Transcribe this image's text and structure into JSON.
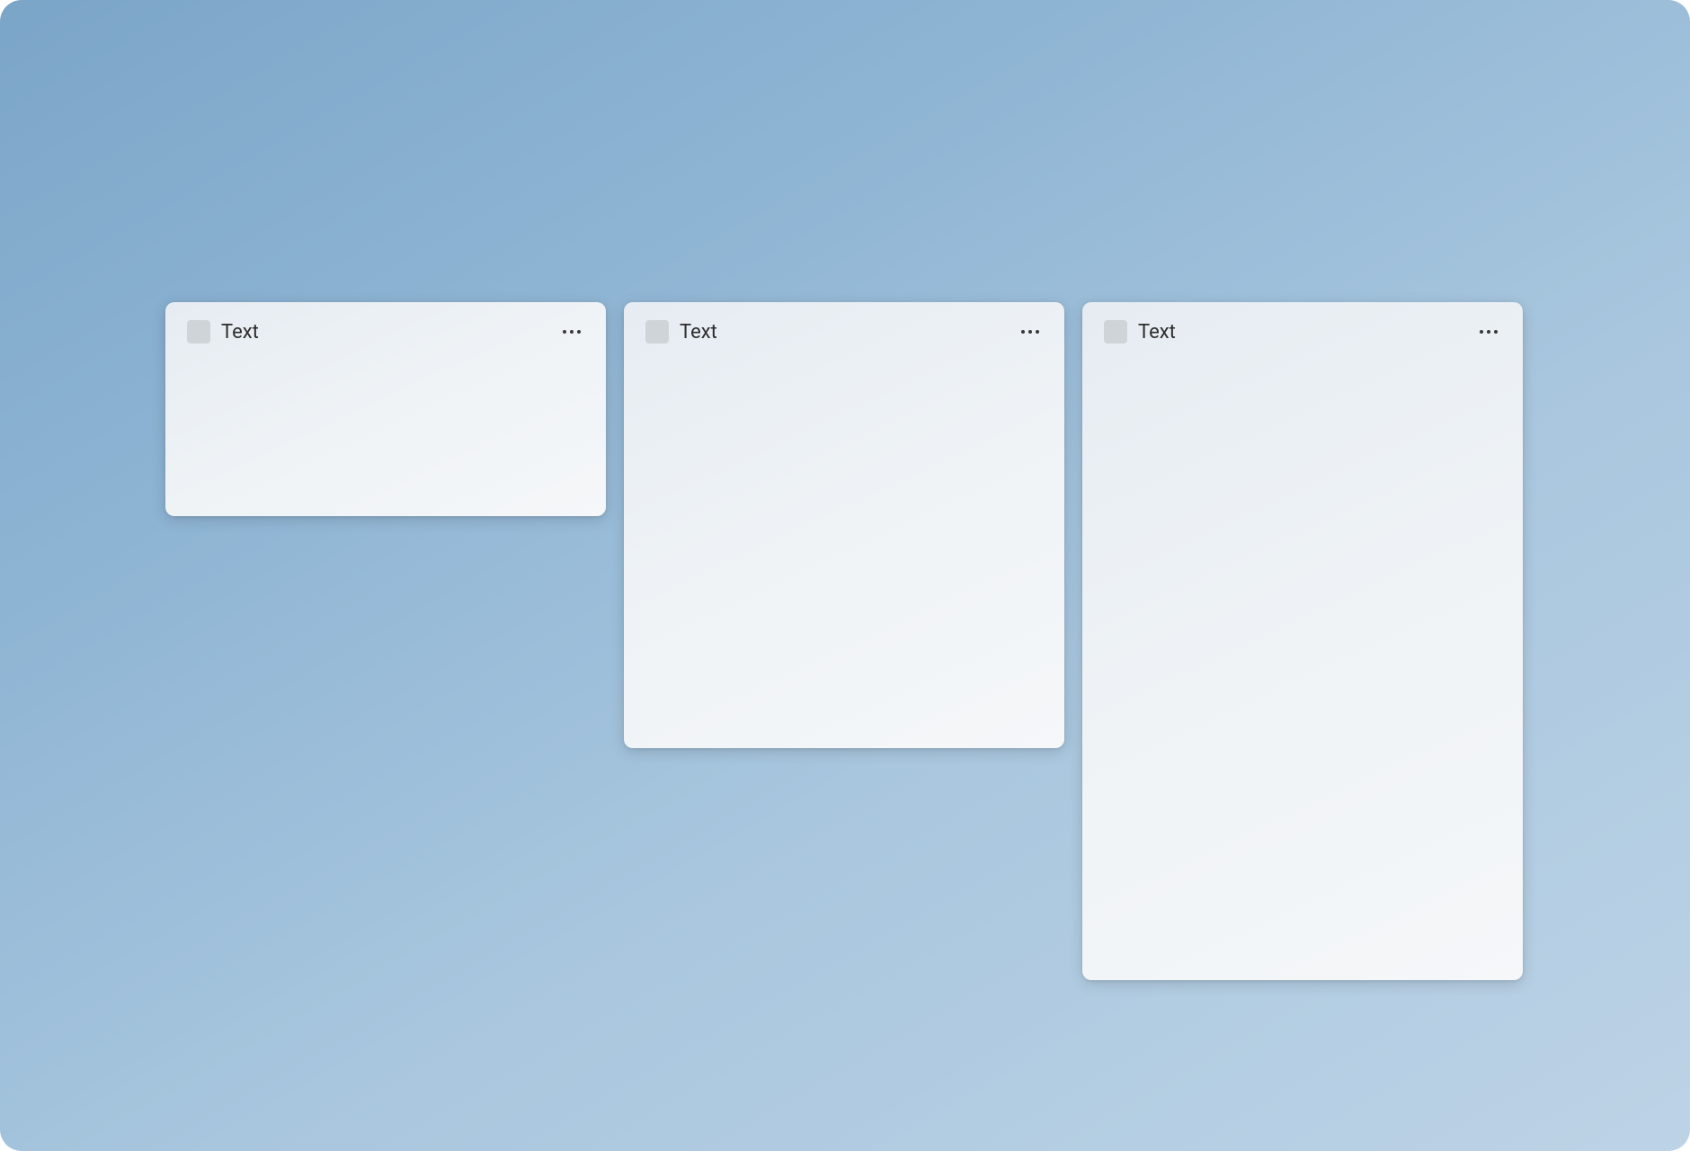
{
  "cards": [
    {
      "title": "Text"
    },
    {
      "title": "Text"
    },
    {
      "title": "Text"
    }
  ]
}
